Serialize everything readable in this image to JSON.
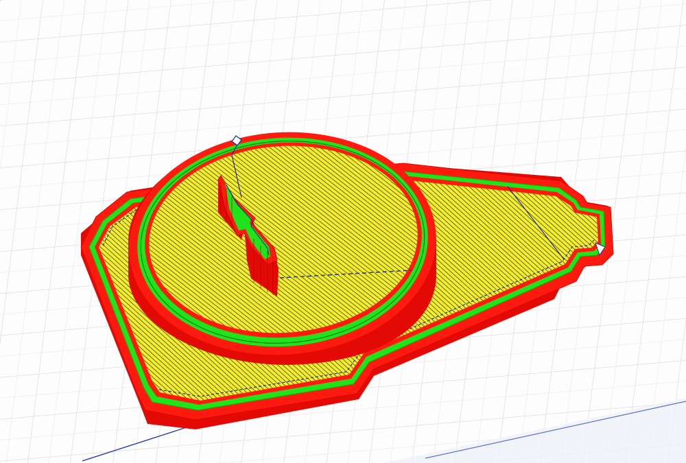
{
  "viewer": {
    "view": "layer-preview",
    "colors": {
      "background": "#fdfdfd",
      "grid": "#d9d9d9",
      "outer_wall": "#ff1a10",
      "outer_wall_side": "#e30a06",
      "inner_wall": "#1fe41c",
      "infill": "#f4ef2a",
      "infill_hatch": "#1a1a10",
      "travel_move": "#1c2a9a",
      "seam": "#1c2a9a"
    },
    "icons": [
      "travel-path-icon"
    ]
  }
}
